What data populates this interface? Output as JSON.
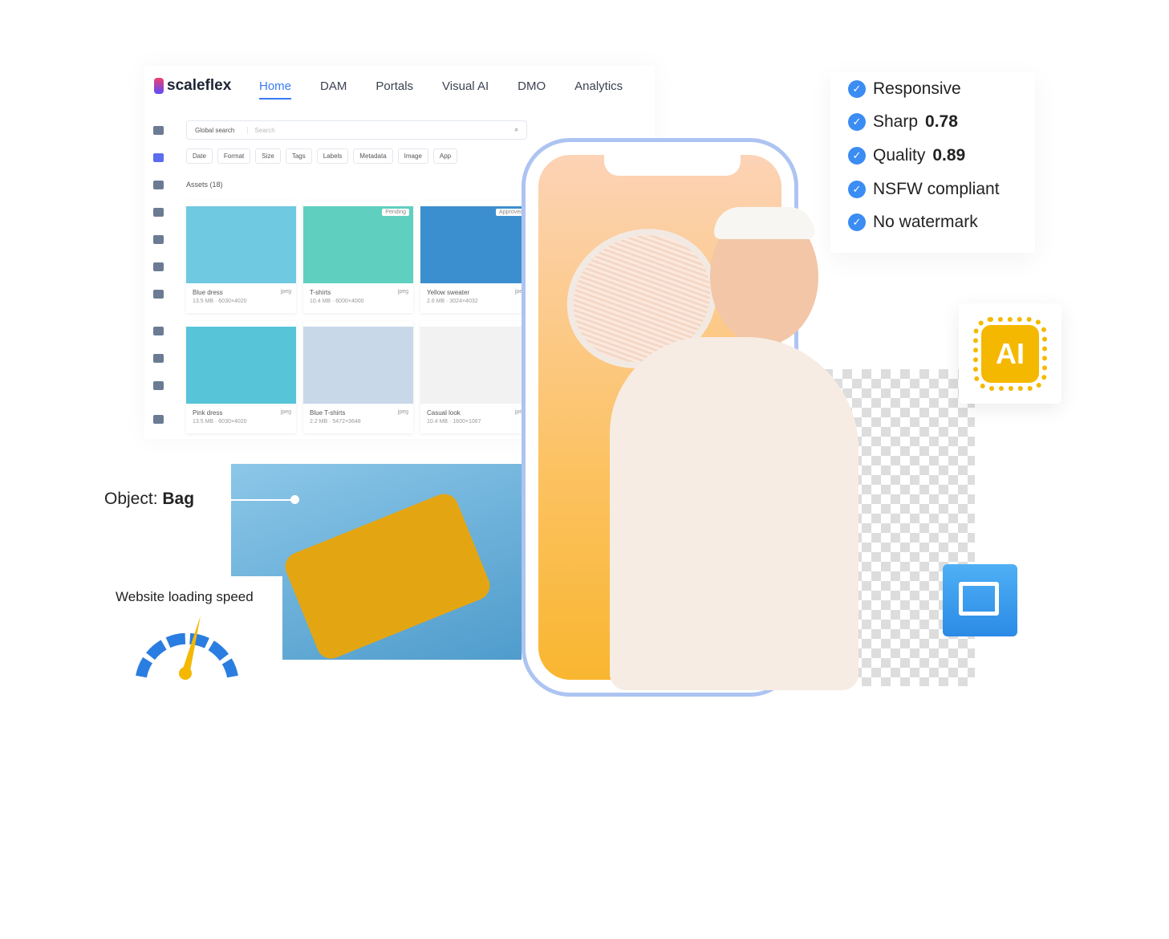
{
  "app": {
    "brand": "scaleflex",
    "nav": [
      "Home",
      "DAM",
      "Portals",
      "Visual AI",
      "DMO",
      "Analytics"
    ],
    "active_nav": "Home",
    "search": {
      "scope": "Global search",
      "placeholder": "Search"
    },
    "filters": [
      "Date",
      "Format",
      "Size",
      "Tags",
      "Labels",
      "Metadata",
      "Image",
      "App"
    ],
    "assets_label": "Assets (18)",
    "cards": [
      {
        "title": "Blue dress",
        "format": "jpeg",
        "meta": "13.5 MB · 6030×4020",
        "badge": ""
      },
      {
        "title": "T-shirts",
        "format": "jpeg",
        "meta": "10.4 MB · 6000×4000",
        "badge": "Pending"
      },
      {
        "title": "Yellow sweater",
        "format": "jpeg",
        "meta": "2.6 MB · 3024×4032",
        "badge": "Approved"
      },
      {
        "title": "Pink dress",
        "format": "jpeg",
        "meta": "13.5 MB · 6030×4020",
        "badge": ""
      },
      {
        "title": "Blue T-shirts",
        "format": "jpeg",
        "meta": "2.2 MB · 5472×3648",
        "badge": ""
      },
      {
        "title": "Casual look",
        "format": "jpeg",
        "meta": "10.4 MB · 1600×1067",
        "badge": ""
      }
    ]
  },
  "checks": [
    "Responsive",
    "Sharp",
    "Quality",
    "NSFW compliant",
    "No watermark"
  ],
  "check_values": [
    "",
    "0.78",
    "0.89",
    "",
    ""
  ],
  "object": {
    "label": "Object: ",
    "value": "Bag"
  },
  "speed": {
    "label": "Website loading speed"
  },
  "ai_label": "AI",
  "colors": {
    "accent": "#3a7bf5",
    "check": "#3b8cf3",
    "ai": "#f5b800"
  }
}
